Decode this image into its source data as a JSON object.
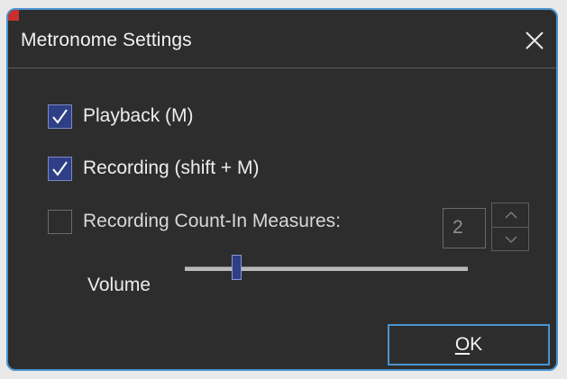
{
  "dialog": {
    "title": "Metronome Settings",
    "accent_color": "#4a93cf",
    "close_icon": "close-icon"
  },
  "options": [
    {
      "label": "Playback (M)",
      "checked": true
    },
    {
      "label": "Recording (shift + M)",
      "checked": true
    },
    {
      "label": "Recording Count-In Measures:",
      "checked": false
    }
  ],
  "count_in": {
    "value": "2",
    "enabled": false,
    "up_icon": "chevron-up-icon",
    "down_icon": "chevron-down-icon"
  },
  "volume": {
    "label": "Volume",
    "level": 0.17
  },
  "ok_button": {
    "mnemonic": "O",
    "rest": "K"
  }
}
